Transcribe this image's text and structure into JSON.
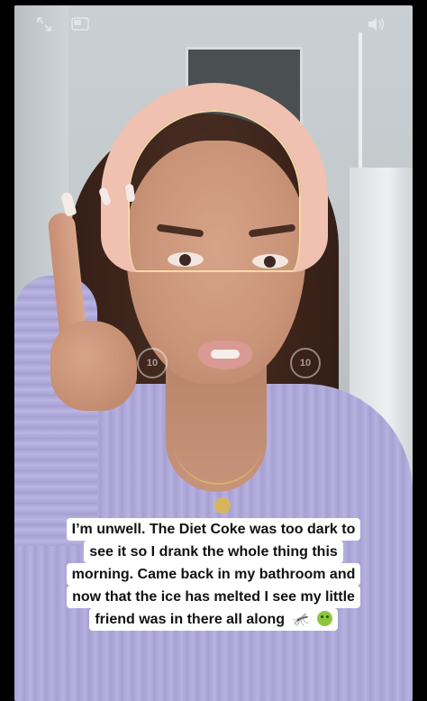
{
  "player": {
    "skip_back_seconds": "10",
    "skip_forward_seconds": "10",
    "icons": {
      "fullscreen": "expand-arrows-icon",
      "pip": "picture-in-picture-icon",
      "volume": "speaker-icon",
      "skip_back": "rewind-10-icon",
      "skip_forward": "forward-10-icon"
    }
  },
  "caption": {
    "lines": [
      "I’m unwell. The Diet Coke was too dark to",
      "see it so I drank the whole thing this",
      "morning. Came back in my bathroom and",
      "now that the ice has melted I see my little",
      "friend was in there all along"
    ],
    "emojis": [
      "mosquito-icon",
      "nauseated-face-icon"
    ],
    "background_color": "#ffffff",
    "text_color": "#111111"
  }
}
